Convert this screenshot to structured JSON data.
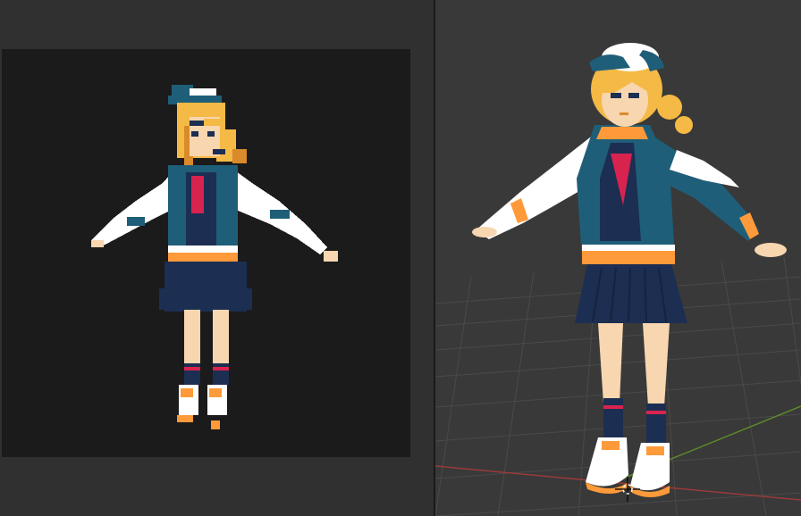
{
  "window": {
    "layout": "split-view"
  },
  "colors": {
    "panel_bg": "#303030",
    "canvas_bg": "#1b1b1b",
    "viewport_bg": "#393939",
    "grid_line": "#4a4a4a",
    "axis_x": "#9a3a3a",
    "axis_y": "#5b8a2a",
    "hair": "#f5b945",
    "hair_shadow": "#d98a2a",
    "skin": "#f7d6b0",
    "jacket": "#1f5e78",
    "sleeve": "#ffffff",
    "navy": "#1c2e52",
    "tie": "#d8234f",
    "accent_orange": "#ff9a3a"
  },
  "icons": {
    "pixel_character": "pixel-character-icon",
    "model_character": "3d-character-icon",
    "origin_cursor": "3d-cursor-icon"
  }
}
